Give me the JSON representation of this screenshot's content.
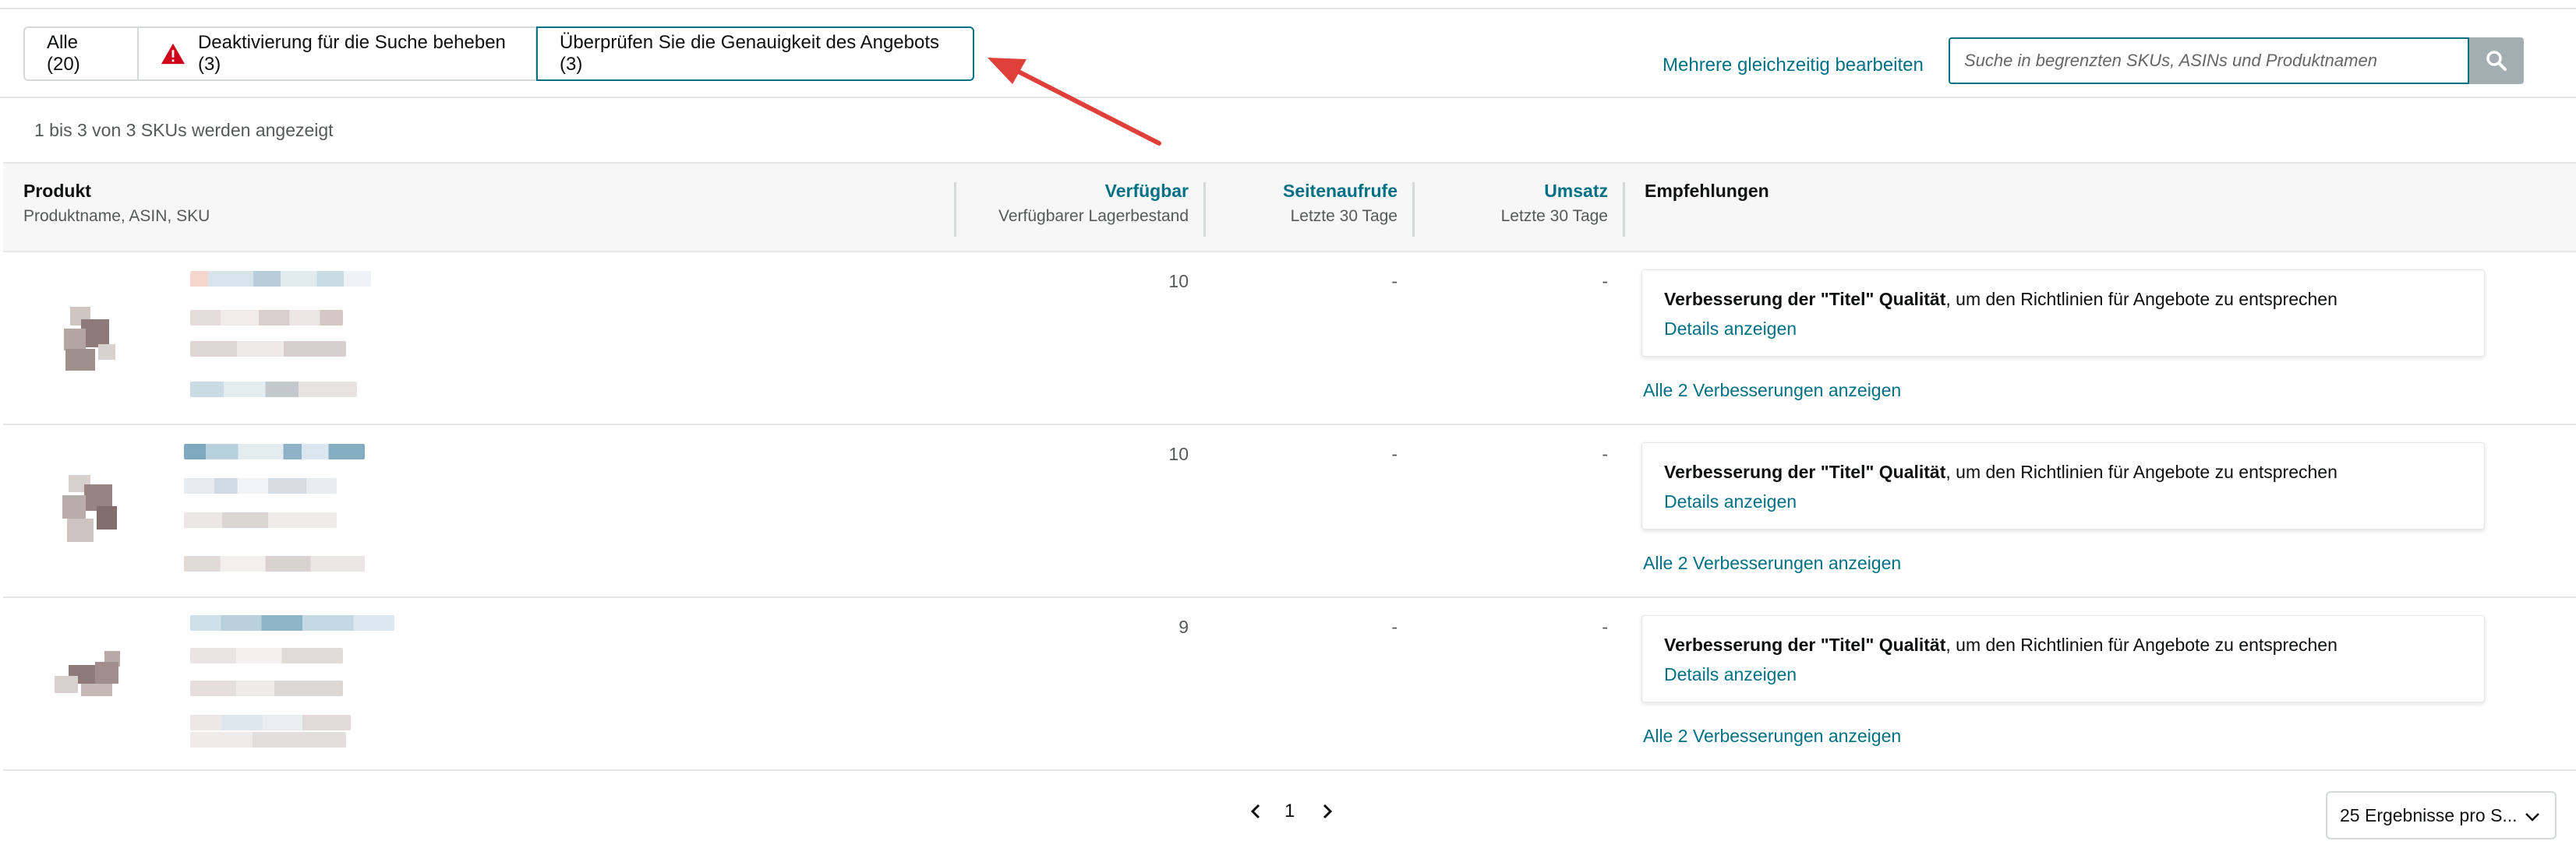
{
  "tabs": {
    "all": "Alle (20)",
    "deactivation": "Deaktivierung für die Suche beheben (3)",
    "review": "Überprüfen Sie die Genauigkeit des Angebots (3)"
  },
  "toolbar": {
    "bulk_edit": "Mehrere gleichzeitig bearbeiten",
    "search_placeholder": "Suche in begrenzten SKUs, ASINs und Produktnamen"
  },
  "summary": "1 bis 3 von 3 SKUs werden angezeigt",
  "columns": {
    "product": {
      "title": "Produkt",
      "sub": "Produktname, ASIN, SKU"
    },
    "available": {
      "title": "Verfügbar",
      "sub": "Verfügbarer Lagerbestand"
    },
    "pageviews": {
      "title": "Seitenaufrufe",
      "sub": "Letzte 30 Tage"
    },
    "sales": {
      "title": "Umsatz",
      "sub": "Letzte 30 Tage"
    },
    "recommendations": {
      "title": "Empfehlungen"
    }
  },
  "rows": [
    {
      "available": "10",
      "pageviews": "-",
      "sales": "-"
    },
    {
      "available": "10",
      "pageviews": "-",
      "sales": "-"
    },
    {
      "available": "9",
      "pageviews": "-",
      "sales": "-"
    }
  ],
  "recommendation": {
    "bold": "Verbesserung der \"Titel\" Qualität",
    "rest": ", um den Richtlinien für Angebote zu entsprechen",
    "details": "Details anzeigen",
    "all": "Alle 2 Verbesserungen anzeigen"
  },
  "pagination": {
    "current": "1"
  },
  "per_page": "25 Ergebnisse pro S...",
  "colors": {
    "link": "#007185",
    "warning": "#d0021b",
    "annotation_arrow": "#e0403a"
  },
  "icons": [
    "warning-icon",
    "search-icon",
    "chevron-left-icon",
    "chevron-right-icon",
    "chevron-down-icon"
  ]
}
